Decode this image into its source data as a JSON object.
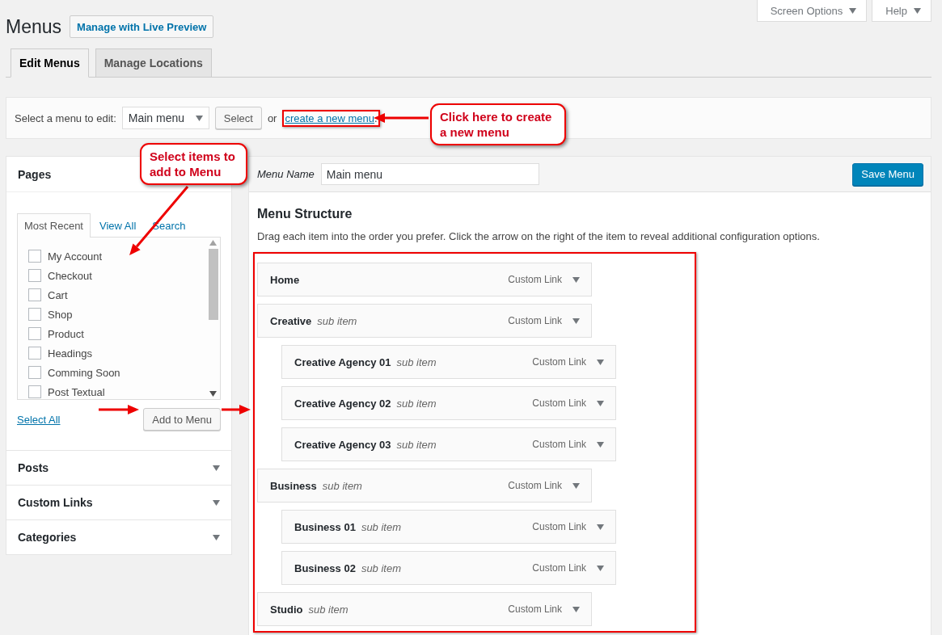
{
  "page_title": "Menus",
  "header_button": "Manage with Live Preview",
  "screen_meta": [
    {
      "label": "Screen Options"
    },
    {
      "label": "Help"
    }
  ],
  "tabs": [
    {
      "label": "Edit Menus",
      "selected": true
    },
    {
      "label": "Manage Locations",
      "selected": false
    }
  ],
  "menu_select": {
    "label": "Select a menu to edit:",
    "value": "Main menu",
    "button": "Select",
    "or_text": "or",
    "link": "create a new menu",
    "after_link": "."
  },
  "sections": [
    {
      "title": "Pages",
      "expanded": true,
      "tabs": [
        {
          "label": "Most Recent",
          "selected": true
        },
        {
          "label": "View All",
          "selected": false
        },
        {
          "label": "Search",
          "selected": false
        }
      ],
      "items": [
        {
          "label": "My Account",
          "checked": false
        },
        {
          "label": "Checkout",
          "checked": false
        },
        {
          "label": "Cart",
          "checked": false
        },
        {
          "label": "Shop",
          "checked": false
        },
        {
          "label": "Product",
          "checked": false
        },
        {
          "label": "Headings",
          "checked": false
        },
        {
          "label": "Comming Soon",
          "checked": false
        },
        {
          "label": "Post Textual",
          "checked": false
        }
      ],
      "select_all": "Select All",
      "add_button": "Add to Menu"
    },
    {
      "title": "Posts",
      "expanded": false
    },
    {
      "title": "Custom Links",
      "expanded": false
    },
    {
      "title": "Categories",
      "expanded": false
    }
  ],
  "menu_editor": {
    "name_label": "Menu Name",
    "name_value": "Main menu",
    "save_button": "Save Menu",
    "heading": "Menu Structure",
    "description": "Drag each item into the order you prefer. Click the arrow on the right of the item to reveal additional configuration options.",
    "items": [
      {
        "title": "Home",
        "type": "Custom Link"
      },
      {
        "title": "Creative",
        "note": "sub item",
        "type": "Custom Link",
        "children": [
          {
            "title": "Creative Agency 01",
            "note": "sub item",
            "type": "Custom Link"
          },
          {
            "title": "Creative Agency 02",
            "note": "sub item",
            "type": "Custom Link"
          },
          {
            "title": "Creative Agency 03",
            "note": "sub item",
            "type": "Custom Link"
          }
        ]
      },
      {
        "title": "Business",
        "note": "sub item",
        "type": "Custom Link",
        "children": [
          {
            "title": "Business 01",
            "note": "sub item",
            "type": "Custom Link"
          },
          {
            "title": "Business 02",
            "note": "sub item",
            "type": "Custom Link"
          }
        ]
      },
      {
        "title": "Studio",
        "note": "sub item",
        "type": "Custom Link"
      }
    ]
  },
  "annotations": [
    {
      "kind": "callout",
      "text": "Click here to create a new menu"
    },
    {
      "kind": "callout",
      "text": "Select items to add to Menu"
    }
  ]
}
